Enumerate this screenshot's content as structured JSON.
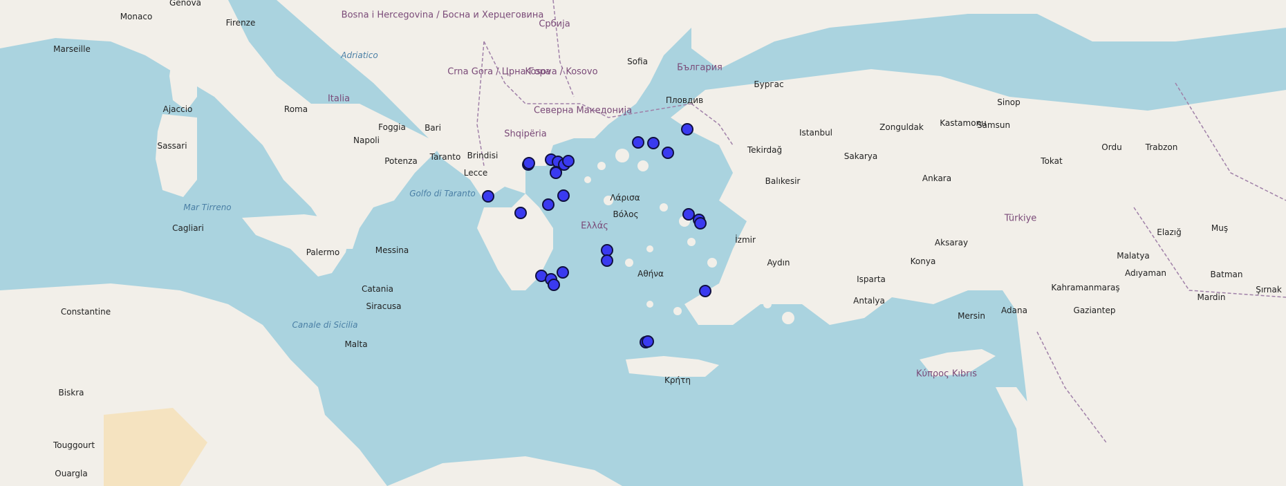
{
  "map": {
    "colors": {
      "sea": "#aad3df",
      "land": "#f2efe9",
      "marker_fill": "#3a3af0",
      "marker_stroke": "#101040",
      "border": "#a080a8"
    },
    "labels": {
      "seas": [
        "Adriatico",
        "Mar Tirreno",
        "Golfo di Taranto",
        "Canale di Sicilia"
      ],
      "countries": [
        "Italia",
        "Shqipëria",
        "Северна Македонија",
        "Ελλάς",
        "България",
        "Türkiye",
        "Κύπρος Kıbrıs",
        "Crna Gora / Црна Гора",
        "Kosova / Kosovo",
        "Србија",
        "Bosna i Hercegovina / Босна и Херцеговина"
      ],
      "cities": [
        "Monaco",
        "Genova",
        "Firenze",
        "Marseille",
        "Roma",
        "Bari",
        "Napoli",
        "Sassari",
        "Ajaccio",
        "Cagliari",
        "Palermo",
        "Messina",
        "Catania",
        "Siracusa",
        "Malta",
        "Taranto",
        "Brindisi",
        "Lecce",
        "Potenza",
        "Foggia",
        "Sofia",
        "Пловдив",
        "Бургас",
        "Tekirdağ",
        "Istanbul",
        "Ankara",
        "Balıkesir",
        "İzmir",
        "Aydın",
        "Antalya",
        "Isparta",
        "Trabzon",
        "Samsun",
        "Sakarya",
        "Zonguldak",
        "Kastamonu",
        "Sinop",
        "Ordu",
        "Tokat",
        "Aksaray",
        "Konya",
        "Adana",
        "Mersin",
        "Gaziantep",
        "Kahramanmaraş",
        "Adıyaman",
        "Malatya",
        "Elazığ",
        "Batman",
        "Muş",
        "Mardin",
        "Şırnak",
        "Αθήνα",
        "Βόλος",
        "Λάρισα",
        "Κρήτη",
        "Constantine",
        "Biskra",
        "Touggourt",
        "Ouargla",
        "Sinop"
      ]
    },
    "markers": [
      {
        "lat": 39.62,
        "lon": 19.92
      },
      {
        "lat": 40.52,
        "lon": 21.26
      },
      {
        "lat": 40.56,
        "lon": 21.28
      },
      {
        "lat": 40.65,
        "lon": 22.0
      },
      {
        "lat": 40.6,
        "lon": 22.24
      },
      {
        "lat": 40.52,
        "lon": 22.45
      },
      {
        "lat": 40.62,
        "lon": 22.58
      },
      {
        "lat": 40.3,
        "lon": 22.18
      },
      {
        "lat": 40.29,
        "lon": 22.17
      },
      {
        "lat": 39.64,
        "lon": 22.42
      },
      {
        "lat": 39.37,
        "lon": 21.92
      },
      {
        "lat": 39.15,
        "lon": 21.0
      },
      {
        "lat": 41.14,
        "lon": 24.89
      },
      {
        "lat": 41.12,
        "lon": 25.4
      },
      {
        "lat": 40.85,
        "lon": 25.87
      },
      {
        "lat": 41.5,
        "lon": 26.5
      },
      {
        "lat": 39.1,
        "lon": 26.55
      },
      {
        "lat": 38.95,
        "lon": 26.9
      },
      {
        "lat": 38.85,
        "lon": 26.95
      },
      {
        "lat": 38.06,
        "lon": 23.85
      },
      {
        "lat": 37.75,
        "lon": 23.85
      },
      {
        "lat": 37.3,
        "lon": 21.7
      },
      {
        "lat": 37.2,
        "lon": 22.0
      },
      {
        "lat": 37.4,
        "lon": 22.4
      },
      {
        "lat": 37.04,
        "lon": 22.11
      },
      {
        "lat": 36.85,
        "lon": 27.1
      },
      {
        "lat": 35.33,
        "lon": 25.13
      },
      {
        "lat": 35.35,
        "lon": 25.2
      }
    ]
  }
}
